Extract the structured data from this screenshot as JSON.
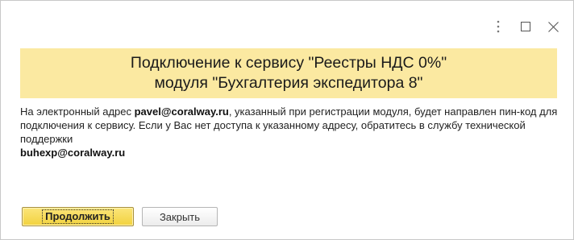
{
  "window": {
    "controls": {
      "more_icon": "more-vertical-icon",
      "maximize_icon": "maximize-icon",
      "close_icon": "close-icon"
    }
  },
  "banner": {
    "line1": "Подключение к сервису \"Реестры НДС 0%\"",
    "line2": "модуля \"Бухгалтерия экспедитора 8\"",
    "background": "#fbe9a1"
  },
  "message": {
    "part1": "На электронный адрес ",
    "email": "pavel@coralway.ru",
    "part2": ", указанный при регистрации модуля, будет направлен пин-код для подключения к сервису. Если у Вас нет доступа к указанному адресу, обратитесь в службу технической поддержки ",
    "support_email": "buhexp@coralway.ru"
  },
  "buttons": {
    "continue_label": "Продолжить",
    "close_label": "Закрыть",
    "primary_color": "#f2d23e"
  }
}
